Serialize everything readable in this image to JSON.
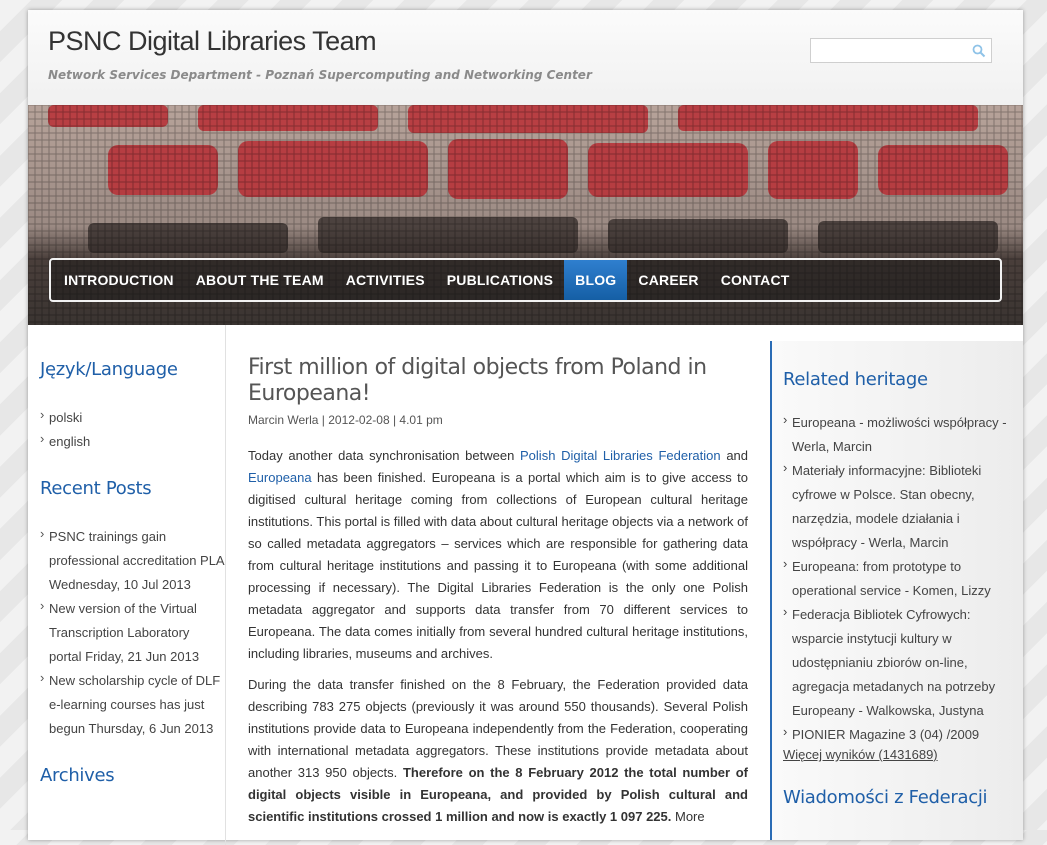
{
  "site": {
    "title": "PSNC Digital Libraries Team",
    "tagline": "Network Services Department - Poznań Supercomputing and Networking Center",
    "search_placeholder": ""
  },
  "nav": [
    {
      "label": "INTRODUCTION",
      "active": false
    },
    {
      "label": "ABOUT THE TEAM",
      "active": false
    },
    {
      "label": "ACTIVITIES",
      "active": false
    },
    {
      "label": "PUBLICATIONS",
      "active": false
    },
    {
      "label": "BLOG",
      "active": true
    },
    {
      "label": "CAREER",
      "active": false
    },
    {
      "label": "CONTACT",
      "active": false
    }
  ],
  "language": {
    "heading": "Język/Language",
    "items": [
      "polski",
      "english"
    ]
  },
  "recent_posts": {
    "heading": "Recent Posts",
    "items": [
      "PSNC trainings gain professional accreditation PLA Wednesday, 10 Jul 2013",
      "New version of the Virtual Transcription Laboratory portal Friday, 21 Jun 2013",
      "New scholarship cycle of DLF e-learning courses has just begun Thursday, 6 Jun 2013"
    ]
  },
  "archives": {
    "heading": "Archives"
  },
  "post": {
    "title": "First million of digital objects from Poland in Europeana!",
    "meta": "Marcin Werla | 2012-02-08 | 4.01 pm",
    "p1_before": "Today another data synchronisation between ",
    "p1_link1": "Polish Digital Libraries Federation",
    "p1_and": " and ",
    "p1_link2": "Europeana",
    "p1_after": " has been finished. Europeana is a portal which aim is to give access to digitised cultural heritage coming from collections of European cultural heritage institutions. This portal is filled with data about cultural heritage objects via a network of so called metadata aggregators – services which are responsible for gathering data from cultural heritage institutions and passing it to Europeana (with some additional processing if necessary). The Digital Libraries Federation is the only one Polish metadata aggregator and supports data transfer from 70 different services to Europeana. The data comes initially from several hundred cultural heritage institutions, including libraries, museums and archives.",
    "p2_before": "During the data transfer finished on the 8 February, the Federation provided data describing 783 275 objects (previously it was around 550 thousands). Several Polish institutions provide data to Europeana independently from the Federation, cooperating with international metadata aggregators. These institutions provide metadata about another 313 950 objects. ",
    "p2_bold": "Therefore on the 8 February 2012 the total number of digital objects visible in Europeana, and provided by Polish cultural and scientific institutions crossed 1 million and now is exactly 1 097 225.",
    "p2_after": " More"
  },
  "related": {
    "heading": "Related heritage",
    "items": [
      "Europeana - możliwości współpracy - Werla, Marcin",
      "Materiały informacyjne: Biblioteki cyfrowe w Polsce. Stan obecny, narzędzia, modele działania i współpracy - Werla, Marcin",
      "Europeana: from prototype to operational service - Komen, Lizzy",
      "Federacja Bibliotek Cyfrowych: wsparcie instytucji kultury w udostępnianiu zbiorów on-line, agregacja metadanych na potrzeby Europeany - Walkowska, Justyna",
      "PIONIER Magazine 3 (04) /2009"
    ],
    "more_link": "Więcej wyników (1431689)",
    "next_heading": "Wiadomości z Federacji"
  },
  "colors": {
    "accent": "#1f5fa8",
    "nav_active": "#1f6fbd",
    "right_border": "#2a6cb5"
  }
}
